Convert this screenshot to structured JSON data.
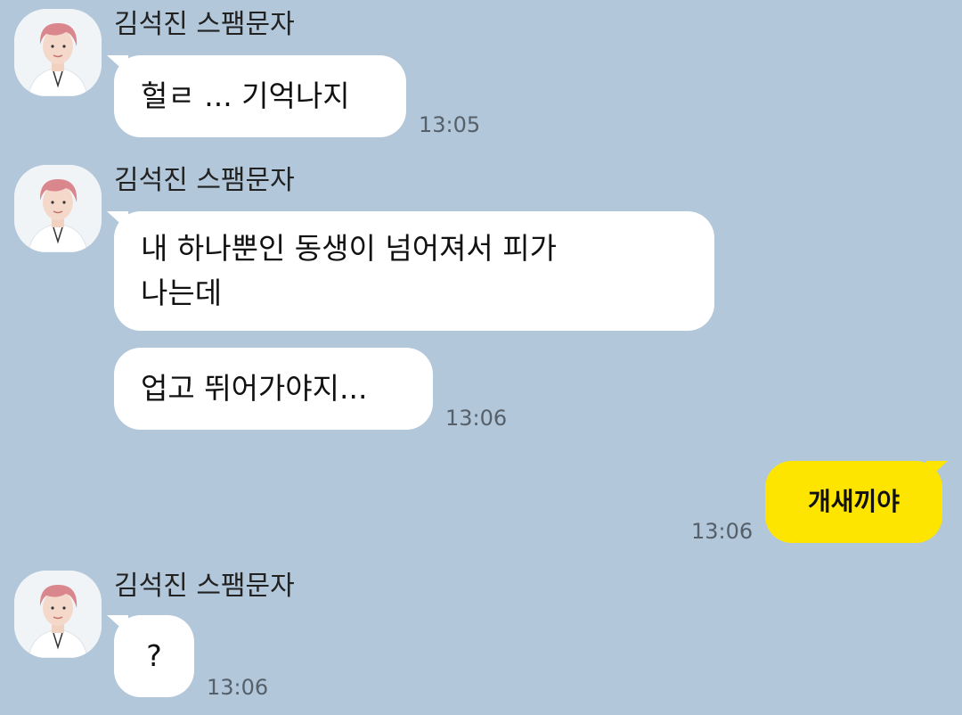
{
  "contact": {
    "name": "김석진 스팸문자"
  },
  "messages": [
    {
      "text": "헐ㄹ ... 기억나지",
      "time": "13:05"
    },
    {
      "text_line1": "내 하나뿐인 동생이 넘어져서 피가",
      "text_line2": "나는데"
    },
    {
      "text": "업고 뛰어가야지...",
      "time": "13:06"
    },
    {
      "text": "개새끼야",
      "time": "13:06"
    },
    {
      "text": "?",
      "time": "13:06"
    }
  ],
  "colors": {
    "background": "#b2c7d9",
    "incoming_bubble": "#ffffff",
    "outgoing_bubble": "#fee500"
  },
  "icons": {
    "avatar": "profile-photo"
  }
}
